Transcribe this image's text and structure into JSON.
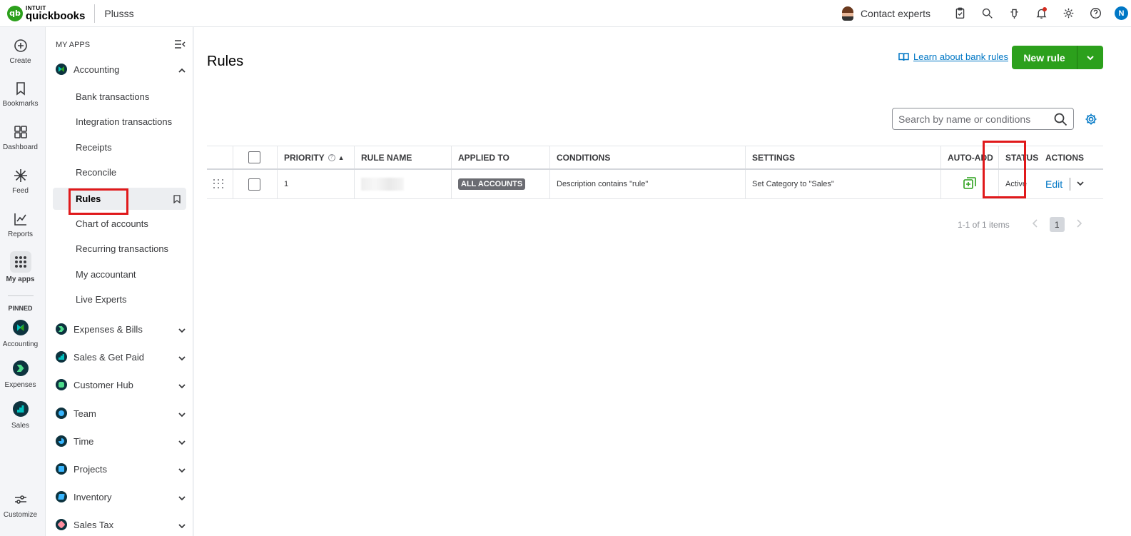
{
  "topbar": {
    "brand_top": "INTUIT",
    "brand_name": "quickbooks",
    "company": "Plusss",
    "contact_label": "Contact experts",
    "user_initial": "N"
  },
  "rail": {
    "create": "Create",
    "bookmarks": "Bookmarks",
    "dashboard": "Dashboard",
    "feed": "Feed",
    "reports": "Reports",
    "my_apps": "My apps",
    "pinned": "PINNED",
    "pinned_accounting": "Accounting",
    "pinned_expenses": "Expenses",
    "pinned_sales": "Sales",
    "customize": "Customize"
  },
  "sidebar": {
    "heading": "MY APPS",
    "accounting": "Accounting",
    "sub_items": [
      "Bank transactions",
      "Integration transactions",
      "Receipts",
      "Reconcile",
      "Rules",
      "Chart of accounts",
      "Recurring transactions",
      "My accountant",
      "Live Experts"
    ],
    "apps": [
      "Expenses & Bills",
      "Sales & Get Paid",
      "Customer Hub",
      "Team",
      "Time",
      "Projects",
      "Inventory",
      "Sales Tax"
    ]
  },
  "main": {
    "title": "Rules",
    "learn_link": "Learn about bank rules",
    "new_rule": "New rule",
    "search_placeholder": "Search by name or conditions",
    "columns": {
      "priority": "PRIORITY",
      "rule_name": "RULE NAME",
      "applied_to": "APPLIED TO",
      "conditions": "CONDITIONS",
      "settings": "SETTINGS",
      "auto_add": "AUTO-ADD",
      "status": "STATUS",
      "actions": "ACTIONS"
    },
    "rows": [
      {
        "priority": "1",
        "applied_to": "ALL ACCOUNTS",
        "conditions": "Description contains \"rule\"",
        "settings": "Set Category to \"Sales\"",
        "status": "Active",
        "action": "Edit"
      }
    ],
    "pagination": {
      "summary": "1-1 of 1 items",
      "current_page": "1"
    }
  },
  "colors": {
    "brand_green": "#2ca01c",
    "link_blue": "#0077c5",
    "highlight_red": "#e0191b",
    "nav_dark": "#0d333f"
  }
}
